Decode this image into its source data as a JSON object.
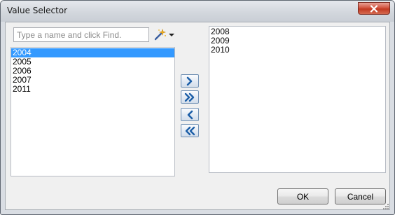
{
  "window": {
    "title": "Value Selector"
  },
  "search": {
    "placeholder": "Type a name and click Find.",
    "value": ""
  },
  "available_list": {
    "items": [
      "2004",
      "2005",
      "2006",
      "2007",
      "2011"
    ],
    "selected_index": 0
  },
  "selected_list": {
    "items": [
      "2008",
      "2009",
      "2010"
    ]
  },
  "buttons": {
    "ok_label": "OK",
    "cancel_label": "Cancel"
  },
  "icons": {
    "close": "close-icon",
    "find": "find-wand-icon",
    "dropdown": "chevron-down-icon",
    "add": "move-right-icon",
    "add_all": "move-all-right-icon",
    "remove": "move-left-icon",
    "remove_all": "move-all-left-icon"
  },
  "colors": {
    "selection": "#3399ff",
    "close_button": "#c7472f",
    "arrow_icon": "#1d5fa8"
  }
}
